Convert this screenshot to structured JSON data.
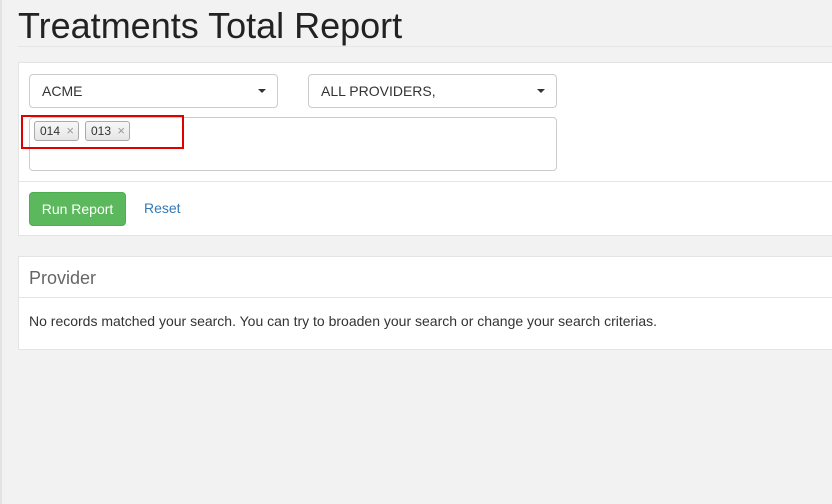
{
  "page": {
    "title": "Treatments Total Report"
  },
  "filters": {
    "company_select": {
      "value": "ACME"
    },
    "provider_select": {
      "value": "ALL PROVIDERS,"
    },
    "tags": [
      {
        "label": "014",
        "remove": "×"
      },
      {
        "label": "013",
        "remove": "×"
      }
    ]
  },
  "actions": {
    "run_label": "Run Report",
    "reset_label": "Reset"
  },
  "results": {
    "heading": "Provider",
    "empty_message": "No records matched your search. You can try to broaden your search or change your search criterias."
  },
  "colors": {
    "primary_button": "#5cb85c",
    "link": "#337ab7",
    "highlight": "#e00000",
    "background": "#f2f2f2"
  }
}
